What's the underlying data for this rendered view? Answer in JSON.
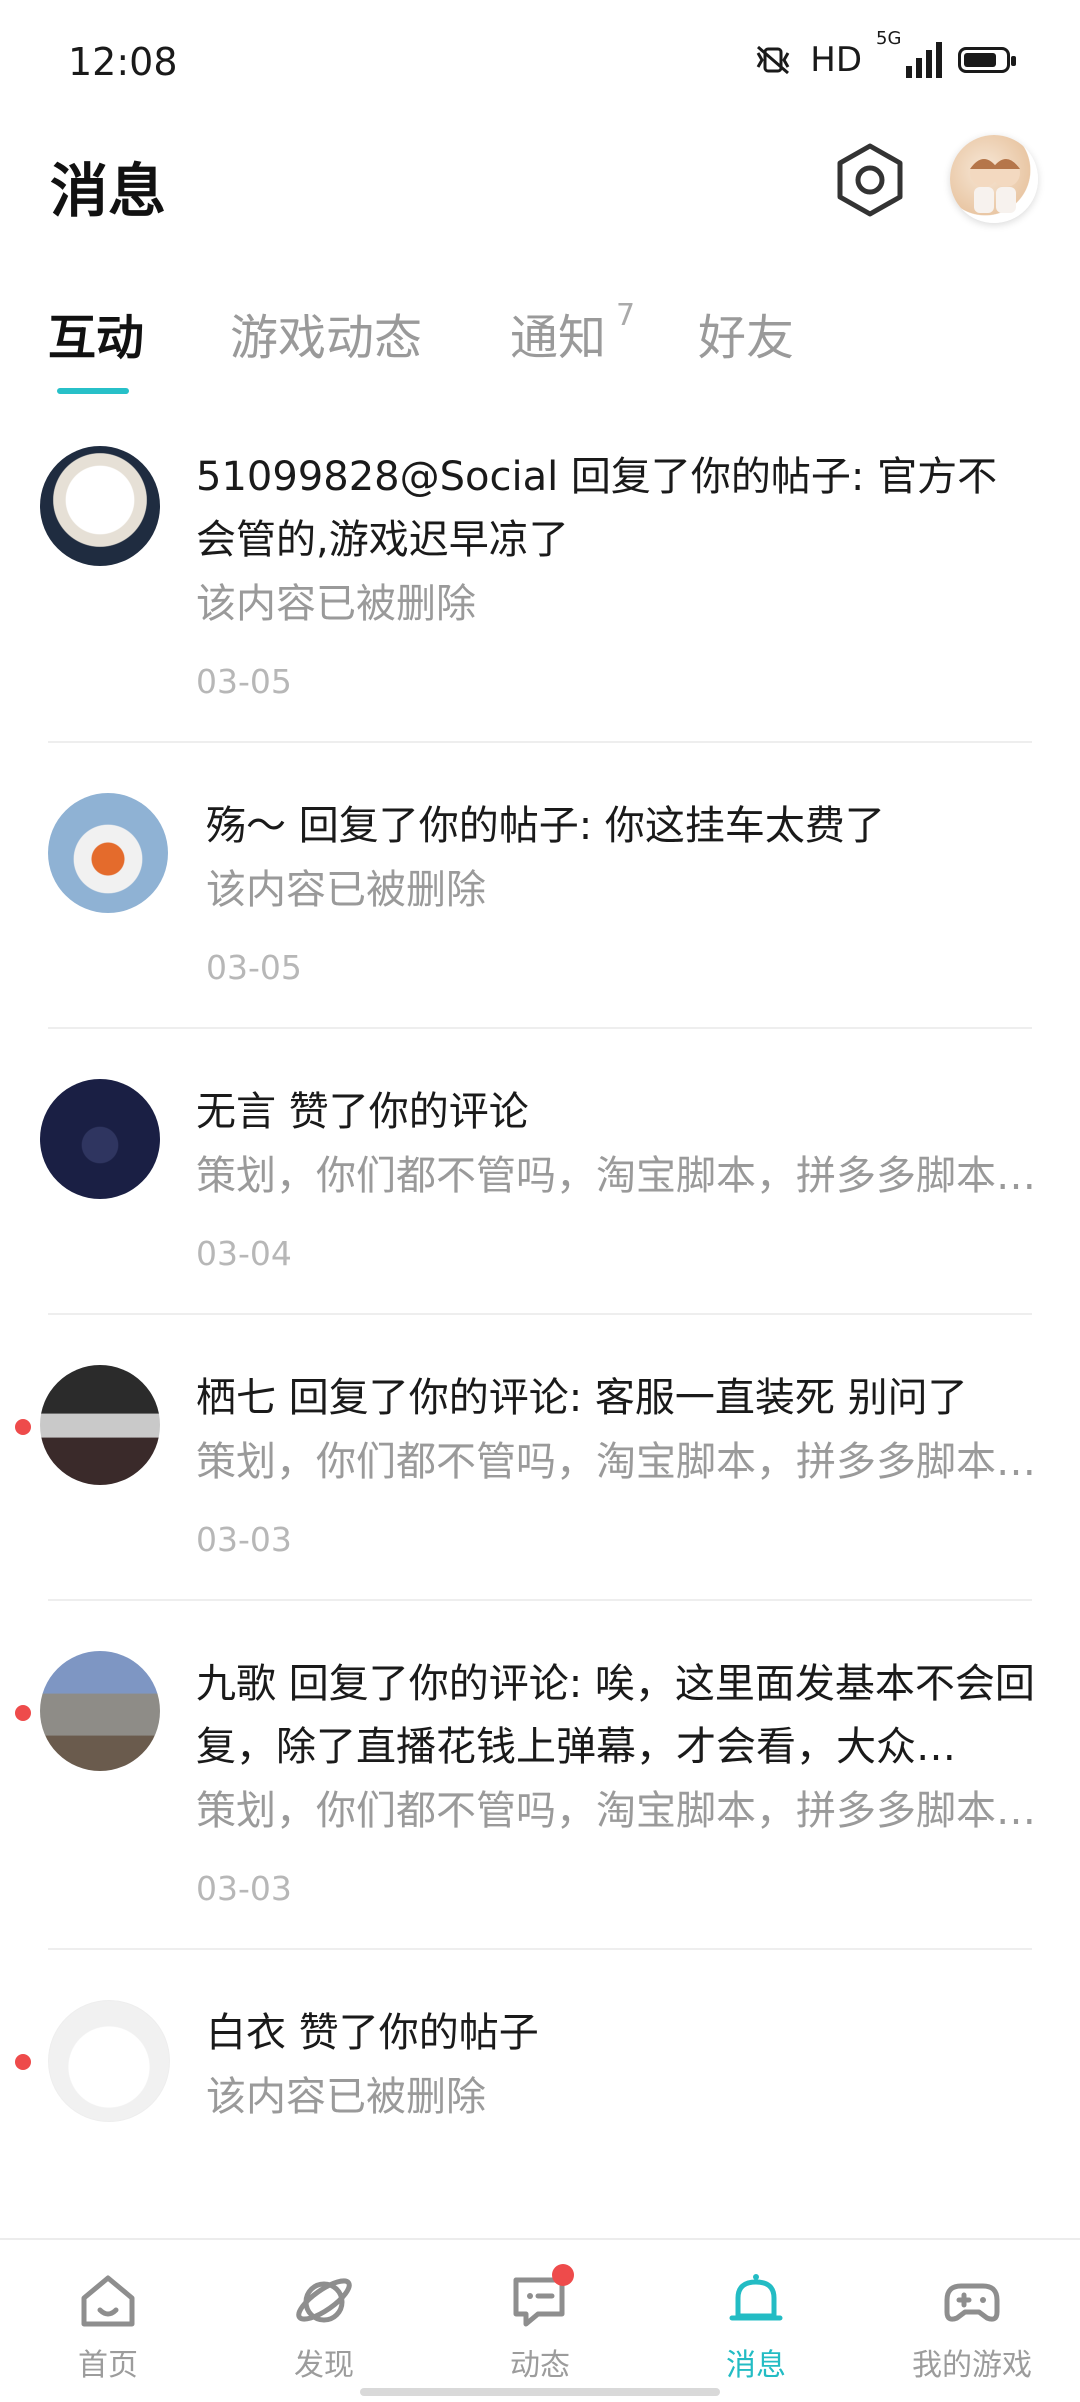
{
  "status_bar": {
    "time": "12:08",
    "network_label": "HD",
    "network_type": "5G"
  },
  "header": {
    "title": "消息"
  },
  "tabs": [
    {
      "label": "互动",
      "active": true
    },
    {
      "label": "游戏动态"
    },
    {
      "label": "通知",
      "badge": "7"
    },
    {
      "label": "好友"
    }
  ],
  "messages": [
    {
      "line1": "51099828@Social 回复了你的帖子: 官方不会管的,游戏迟早凉了",
      "line2": "该内容已被删除",
      "date": "03-05",
      "unread": false
    },
    {
      "line1": "殇～ 回复了你的帖子: 你这挂车太费了",
      "line2": "该内容已被删除",
      "date": "03-05",
      "unread": false
    },
    {
      "line1": "无言 赞了你的评论",
      "line2": "策划，你们都不管吗，淘宝脚本，拼多多脚本…",
      "date": "03-04",
      "unread": false
    },
    {
      "line1": "栖七 回复了你的评论: 客服一直装死  别问了",
      "line2": "策划，你们都不管吗，淘宝脚本，拼多多脚本…",
      "date": "03-03",
      "unread": true
    },
    {
      "line1": "九歌 回复了你的评论: 唉，这里面发基本不会回复，除了直播花钱上弹幕，才会看，大众…",
      "line2": "策划，你们都不管吗，淘宝脚本，拼多多脚本…",
      "date": "03-03",
      "unread": true
    },
    {
      "line1": "白衣 赞了你的帖子",
      "line2": "该内容已被删除",
      "date": "",
      "unread": true
    }
  ],
  "bottom_nav": [
    {
      "label": "首页",
      "icon": "home-icon"
    },
    {
      "label": "发现",
      "icon": "planet-icon"
    },
    {
      "label": "动态",
      "icon": "chat-icon",
      "dot": true
    },
    {
      "label": "消息",
      "icon": "bell-icon",
      "active": true
    },
    {
      "label": "我的游戏",
      "icon": "gamepad-icon"
    }
  ],
  "colors": {
    "accent": "#23bcc4",
    "unread_dot": "#ee4b4b"
  }
}
